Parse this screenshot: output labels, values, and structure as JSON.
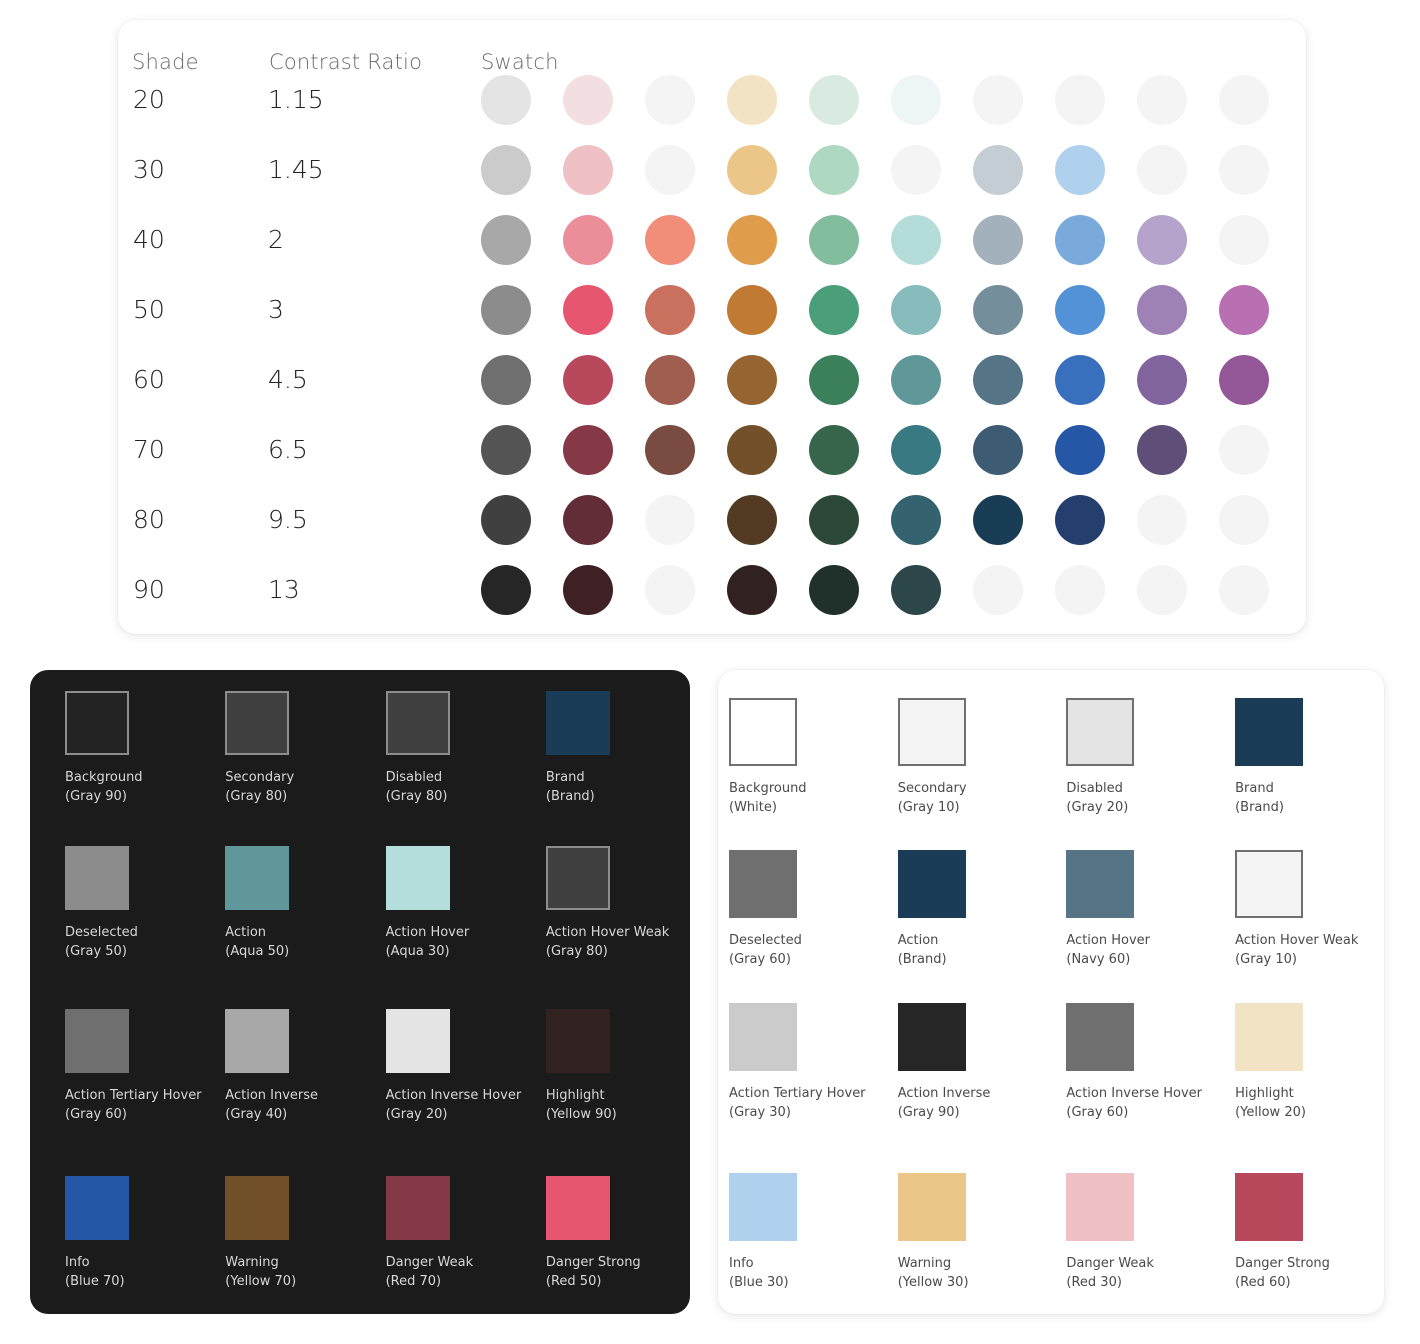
{
  "scale_table": {
    "headers": {
      "shade": "Shade",
      "ratio": "Contrast Ratio",
      "swatch": "Swatch"
    },
    "rows": [
      {
        "shade": "20",
        "ratio": "1.15",
        "swatches": [
          "#e4e4e4",
          "#f3dfe1",
          "#f4f4f4",
          "#f2e3c5",
          "#d9eae1",
          "#eef6f5",
          "#f4f4f4",
          "#f4f4f4",
          "#f4f4f4",
          "#f4f4f4"
        ]
      },
      {
        "shade": "30",
        "ratio": "1.45",
        "swatches": [
          "#cbcbcb",
          "#efc1c5",
          "#f4f4f4",
          "#ecc688",
          "#afd8c2",
          "#f4f4f4",
          "#c4cdd4",
          "#b0d1ed",
          "#f4f4f4",
          "#f4f4f4"
        ]
      },
      {
        "shade": "40",
        "ratio": "2",
        "swatches": [
          "#a8a8a8",
          "#eb8e99",
          "#f08e7a",
          "#df9c4a",
          "#82be9e",
          "#b4ddd9",
          "#a2b1bb",
          "#7aaadc",
          "#b5a3cb",
          "#f4f4f4"
        ]
      },
      {
        "shade": "50",
        "ratio": "3",
        "swatches": [
          "#8c8c8c",
          "#e6576f",
          "#c9705e",
          "#c07a34",
          "#4a9e7a",
          "#88bbbb",
          "#758e9b",
          "#5392d6",
          "#9f82b5",
          "#b870b3"
        ]
      },
      {
        "shade": "60",
        "ratio": "4.5",
        "swatches": [
          "#6f6f6f",
          "#b8485b",
          "#9f5e4f",
          "#966430",
          "#3b7f5b",
          "#60989a",
          "#557486",
          "#3970be",
          "#81649e",
          "#945797"
        ]
      },
      {
        "shade": "70",
        "ratio": "6.5",
        "swatches": [
          "#545454",
          "#853845",
          "#7a4b41",
          "#725029",
          "#36654b",
          "#397981",
          "#3d5b72",
          "#2656a6",
          "#5f4e77",
          "#f4f4f4"
        ]
      },
      {
        "shade": "80",
        "ratio": "9.5",
        "swatches": [
          "#404040",
          "#622d36",
          "#f4f4f4",
          "#533a22",
          "#2c4838",
          "#34626e",
          "#1a3d56",
          "#243f6d",
          "#f4f4f4",
          "#f4f4f4"
        ]
      },
      {
        "shade": "90",
        "ratio": "13",
        "swatches": [
          "#262626",
          "#3f2025",
          "#f4f4f4",
          "#312120",
          "#20302a",
          "#2c464a",
          "#f4f4f4",
          "#f4f4f4",
          "#f4f4f4",
          "#f4f4f4"
        ]
      }
    ]
  },
  "dark_theme": {
    "tokens": [
      {
        "name": "Background",
        "ref": "(Gray 90)",
        "color": "#232323",
        "bordered": true
      },
      {
        "name": "Secondary",
        "ref": "(Gray 80)",
        "color": "#404040",
        "bordered": true
      },
      {
        "name": "Disabled",
        "ref": "(Gray 80)",
        "color": "#404040",
        "bordered": true
      },
      {
        "name": "Brand",
        "ref": "(Brand)",
        "color": "#1a3c56",
        "bordered": false
      },
      {
        "name": "Deselected",
        "ref": "(Gray 50)",
        "color": "#8c8c8c",
        "bordered": false
      },
      {
        "name": "Action",
        "ref": "(Aqua 50)",
        "color": "#5f979a",
        "bordered": false
      },
      {
        "name": "Action Hover",
        "ref": "(Aqua 30)",
        "color": "#b4dedb",
        "bordered": false
      },
      {
        "name": "Action Hover Weak",
        "ref": "(Gray 80)",
        "color": "#404040",
        "bordered": true
      },
      {
        "name": "Action Tertiary Hover",
        "ref": "(Gray 60)",
        "color": "#6f6f6f",
        "bordered": false
      },
      {
        "name": "Action Inverse",
        "ref": "(Gray 40)",
        "color": "#a8a8a8",
        "bordered": false
      },
      {
        "name": "Action Inverse Hover",
        "ref": "(Gray 20)",
        "color": "#e4e4e4",
        "bordered": false
      },
      {
        "name": "Highlight",
        "ref": "(Yellow 90)",
        "color": "#312120",
        "bordered": false
      },
      {
        "name": "Info",
        "ref": "(Blue 70)",
        "color": "#2656a6",
        "bordered": false
      },
      {
        "name": "Warning",
        "ref": "(Yellow 70)",
        "color": "#725029",
        "bordered": false
      },
      {
        "name": "Danger Weak",
        "ref": "(Red 70)",
        "color": "#853845",
        "bordered": false
      },
      {
        "name": "Danger Strong",
        "ref": "(Red 50)",
        "color": "#e6576f",
        "bordered": false
      }
    ]
  },
  "light_theme": {
    "tokens": [
      {
        "name": "Background",
        "ref": "(White)",
        "color": "#ffffff",
        "bordered": true
      },
      {
        "name": "Secondary",
        "ref": "(Gray 10)",
        "color": "#f4f4f4",
        "bordered": true
      },
      {
        "name": "Disabled",
        "ref": "(Gray 20)",
        "color": "#e4e4e4",
        "bordered": true
      },
      {
        "name": "Brand",
        "ref": "(Brand)",
        "color": "#1a3c56",
        "bordered": false
      },
      {
        "name": "Deselected",
        "ref": "(Gray 60)",
        "color": "#6f6f6f",
        "bordered": false
      },
      {
        "name": "Action",
        "ref": "(Brand)",
        "color": "#1a3c56",
        "bordered": false
      },
      {
        "name": "Action Hover",
        "ref": "(Navy 60)",
        "color": "#557486",
        "bordered": false
      },
      {
        "name": "Action Hover Weak",
        "ref": "(Gray 10)",
        "color": "#f4f4f4",
        "bordered": true
      },
      {
        "name": "Action Tertiary Hover",
        "ref": "(Gray 30)",
        "color": "#cbcbcb",
        "bordered": false
      },
      {
        "name": "Action Inverse",
        "ref": "(Gray 90)",
        "color": "#262626",
        "bordered": false
      },
      {
        "name": "Action Inverse Hover",
        "ref": "(Gray 60)",
        "color": "#6f6f6f",
        "bordered": false
      },
      {
        "name": "Highlight",
        "ref": "(Yellow 20)",
        "color": "#f2e3c5",
        "bordered": false
      },
      {
        "name": "Info",
        "ref": "(Blue 30)",
        "color": "#b0d1ed",
        "bordered": false
      },
      {
        "name": "Warning",
        "ref": "(Yellow 30)",
        "color": "#ecc688",
        "bordered": false
      },
      {
        "name": "Danger Weak",
        "ref": "(Red 30)",
        "color": "#efc1c5",
        "bordered": false
      },
      {
        "name": "Danger Strong",
        "ref": "(Red 60)",
        "color": "#b8485b",
        "bordered": false
      }
    ]
  }
}
